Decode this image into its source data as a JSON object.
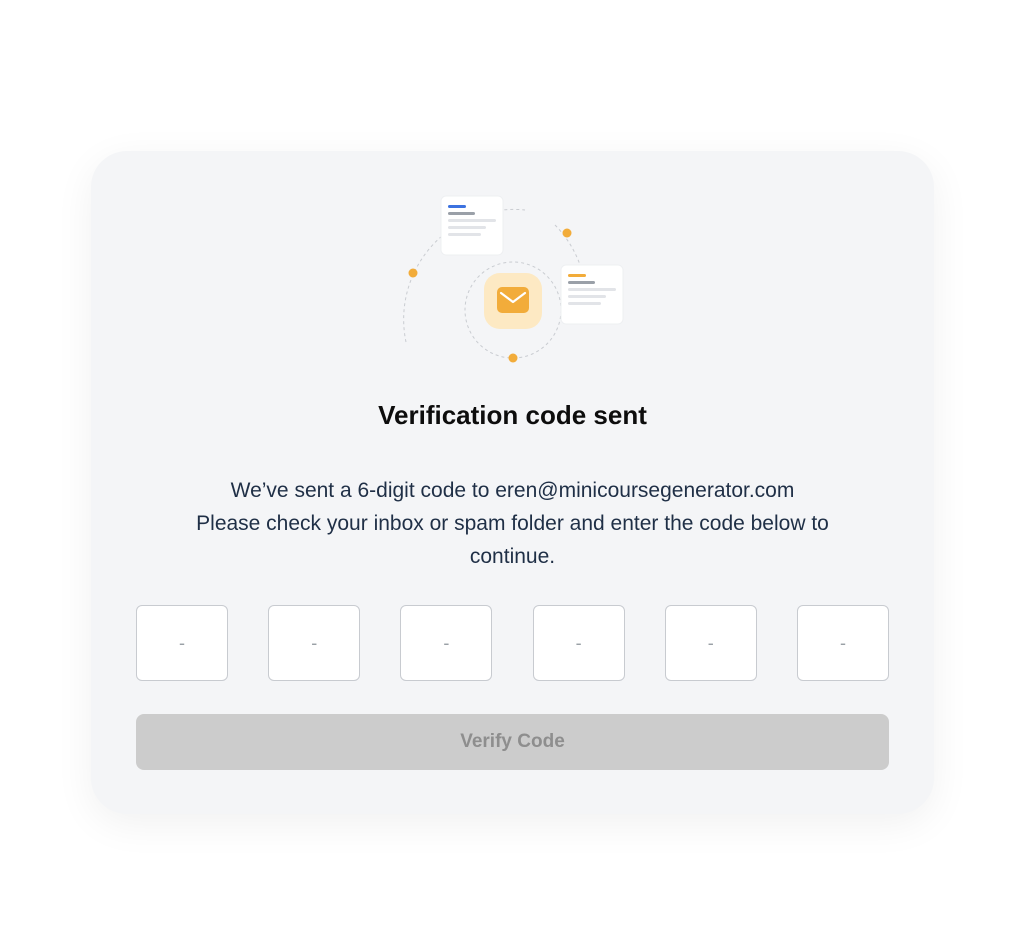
{
  "illustration": {
    "center_icon": "envelope-icon",
    "accent_color": "#f2ac3a",
    "blue_color": "#3c72e0"
  },
  "heading": {
    "title": "Verification code sent"
  },
  "message": {
    "line1": "We’ve sent a 6-digit code to eren@minicoursegenerator.com",
    "line2": "Please check your inbox or spam folder and enter the code below to",
    "line3": "continue."
  },
  "code_inputs": {
    "digits": [
      {
        "value": "",
        "placeholder": "-"
      },
      {
        "value": "",
        "placeholder": "-"
      },
      {
        "value": "",
        "placeholder": "-"
      },
      {
        "value": "",
        "placeholder": "-"
      },
      {
        "value": "",
        "placeholder": "-"
      },
      {
        "value": "",
        "placeholder": "-"
      }
    ]
  },
  "actions": {
    "verify_label": "Verify Code",
    "verify_disabled": true
  }
}
